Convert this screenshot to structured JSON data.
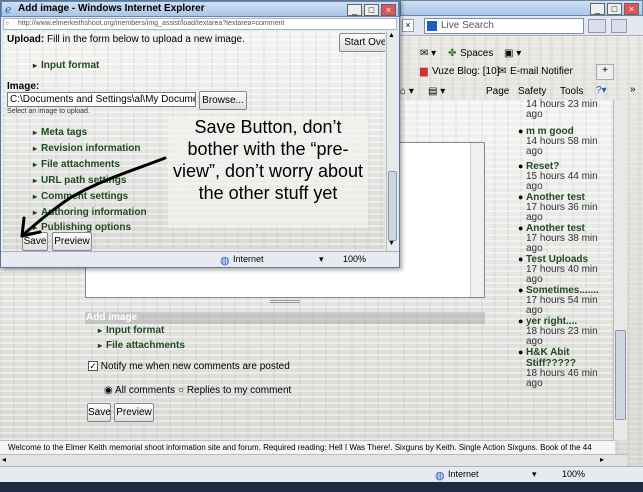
{
  "popup": {
    "title": "Add image - Windows Internet Explorer",
    "url": "http://www.elmerkeithshoot.org/members/img_assist/load/textarea?textarea=comment",
    "upload_label": "Upload:",
    "upload_text": "Fill in the form below to upload a new image.",
    "start_over": "Start Over",
    "input_format": "Input format",
    "image_label": "Image:",
    "file_path": "C:\\Documents and Settings\\al\\My Documents\\",
    "browse": "Browse...",
    "select_hint": "Select an image to upload.",
    "links": [
      "Meta tags",
      "Revision information",
      "File attachments",
      "URL path settings",
      "Comment settings",
      "Authoring information",
      "Publishing options"
    ],
    "save": "Save",
    "preview": "Preview",
    "status_zone": "Internet",
    "zoom": "100%"
  },
  "annotation": "Save Button, don’t bother with the “pre-view”, don’t worry about the other stuff yet",
  "main": {
    "search_placeholder": "Live Search",
    "spaces": "Spaces",
    "vuze": "Vuze Blog: [10]",
    "email": "E-mail Notifier",
    "page": "Page",
    "safety": "Safety",
    "tools": "Tools",
    "add_image": "Add image",
    "input_format": "Input format",
    "file_attachments": "File attachments",
    "notify": "Notify me when new comments are posted",
    "all_comments": "All comments",
    "replies": "Replies to my comment",
    "save": "Save",
    "preview": "Preview",
    "footer": "Welcome to the Elmer Keith memorial shoot information site and forum. Required reading: Hell I Was There!. Sixguns by Keith. Single Action Sixguns. Book of the 44",
    "status_zone": "Internet",
    "zoom": "100%"
  },
  "comments": [
    {
      "title": "",
      "ago": "14 hours 23 min ago"
    },
    {
      "title": "m m good",
      "ago": "14 hours 58 min ago"
    },
    {
      "title": "Reset?",
      "ago": "15 hours 44 min ago"
    },
    {
      "title": "Another test",
      "ago": "17 hours 36 min ago"
    },
    {
      "title": "Another test",
      "ago": "17 hours 38 min ago"
    },
    {
      "title": "Test Uploads",
      "ago": "17 hours 40 min ago"
    },
    {
      "title": "Sometimes.......",
      "ago": "17 hours 54 min ago"
    },
    {
      "title": "yer right....",
      "ago": "18 hours 23 min ago"
    },
    {
      "title": "H&K Abit Stiff?????",
      "ago": "18 hours 46 min ago"
    }
  ]
}
